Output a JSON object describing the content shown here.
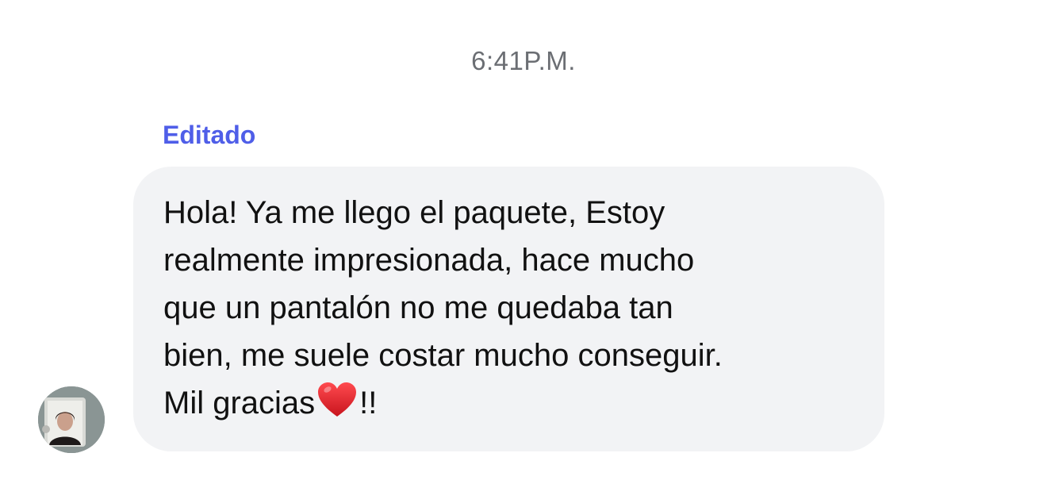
{
  "conversation": {
    "timestamp": "6:41P.M.",
    "message": {
      "edited_label": "Editado",
      "text_main": "Hola! Ya me llego el paquete, Estoy\nrealmente impresionada, hace mucho\nque un pantalón no me quedaba tan\nbien, me suele costar mucho conseguir.\nMil gracias",
      "emoji": "heart-emoji",
      "text_tail": "!!",
      "bubble_color": "#f2f3f5"
    },
    "sender": {
      "avatar": "user-avatar-photo"
    }
  },
  "colors": {
    "edited_label": "#4f5ee8",
    "timestamp": "#6b6e73",
    "heart": "#e0242e"
  }
}
